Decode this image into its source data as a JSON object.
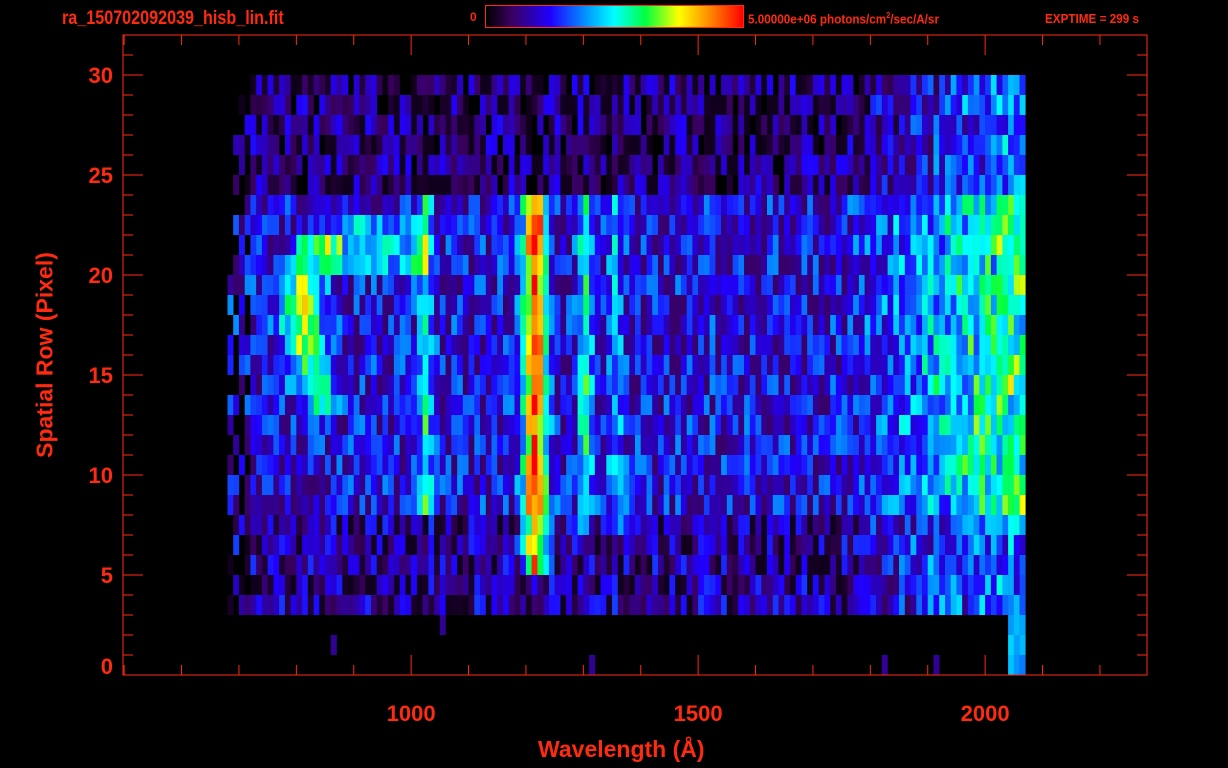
{
  "header": {
    "filename": "ra_150702092039_hisb_lin.fit",
    "colorbar_min": "0",
    "colorbar_max_units": "5.00000e+06 photons/cm",
    "colorbar_units_sup": "2",
    "colorbar_units_tail": "/sec/A/sr",
    "exptime": "EXPTIME = 299 s"
  },
  "colors": {
    "axis": "#ff2a10",
    "background": "#000000"
  },
  "chart_data": {
    "type": "heatmap",
    "title": "ra_150702092039_hisb_lin.fit",
    "xlabel": "Wavelength (Å)",
    "ylabel": "Spatial Row (Pixel)",
    "xlim": [
      498,
      2282
    ],
    "ylim": [
      0,
      32
    ],
    "xticks": [
      1000,
      1500,
      2000
    ],
    "xtick_labels": [
      "1000",
      "1500",
      "2000"
    ],
    "xminor_step": 100,
    "yticks": [
      0,
      5,
      10,
      15,
      20,
      25,
      30
    ],
    "ytick_labels": [
      "0",
      "5",
      "10",
      "15",
      "20",
      "25",
      "30"
    ],
    "yminor_step": 1,
    "zlim": [
      0,
      5000000
    ],
    "colormap": "rainbow",
    "colormap_stops": [
      [
        0,
        "#000000"
      ],
      [
        0.1,
        "#3a0060"
      ],
      [
        0.25,
        "#2000ff"
      ],
      [
        0.4,
        "#00a0ff"
      ],
      [
        0.5,
        "#00ffff"
      ],
      [
        0.62,
        "#00ff40"
      ],
      [
        0.75,
        "#ffff00"
      ],
      [
        0.88,
        "#ff8000"
      ],
      [
        1,
        "#ff0000"
      ]
    ],
    "wavelength_range": [
      680,
      2065
    ],
    "bin_width": 10,
    "rows": 30,
    "model": {
      "background": 0.17,
      "noise": 0.14,
      "lit_rows": [
        3,
        30
      ],
      "slit_rows": [
        8,
        24
      ],
      "emission_lines": [
        {
          "wavelength": 1026,
          "amplitude": 0.3,
          "width": 8,
          "rows": [
            8,
            24
          ]
        },
        {
          "wavelength": 1216,
          "amplitude": 0.72,
          "width": 14,
          "rows": [
            5,
            24
          ]
        },
        {
          "wavelength": 1304,
          "amplitude": 0.3,
          "width": 9,
          "rows": [
            7,
            24
          ]
        },
        {
          "wavelength": 1356,
          "amplitude": 0.18,
          "width": 9,
          "rows": [
            7,
            24
          ]
        }
      ],
      "arc": {
        "wavelength": 830,
        "amplitude": 0.45,
        "rows": [
          13,
          22
        ],
        "curvature": 40
      },
      "red_continuum": {
        "start": 1750,
        "end": 2062,
        "amplitude": 0.38
      }
    }
  }
}
